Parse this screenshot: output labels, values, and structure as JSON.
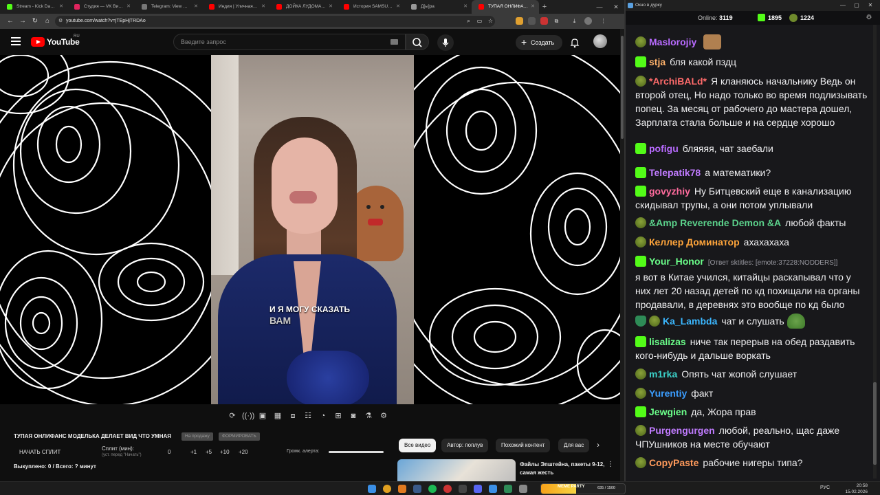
{
  "browser": {
    "tabs": [
      {
        "label": "Stream - Kick Dashboard",
        "color": "#53fc18"
      },
      {
        "label": "Студия — VK Видео | Стрим",
        "color": "#e0245e"
      },
      {
        "label": "Telegram: View @agree",
        "color": "#777777"
      },
      {
        "label": "Индия | Уличная Медь...",
        "color": "#ff0000"
      },
      {
        "label": "ДОЙКА ЛУДОМАНОВ",
        "color": "#ff0000"
      },
      {
        "label": "История SAMSUNG. К...",
        "color": "#ff0000"
      },
      {
        "label": "Д[ы]ра",
        "color": "#999999"
      },
      {
        "label": "ТУПАЯ ОНЛИФАНС М...",
        "color": "#ff0000",
        "active": true
      }
    ],
    "url": "youtube.com/watch?v=jTEpHjTRDAo"
  },
  "youtube": {
    "logo_text": "YouTube",
    "region": "RU",
    "search_placeholder": "Введите запрос",
    "create_label": "Создать",
    "caption_line1": "И Я МОГУ СКАЗАТЬ",
    "caption_line2": "ВАМ",
    "video_title": "ТУПАЯ ОНЛИФАНС МОДЕЛЬКА ДЕЛАЕТ ВИД ЧТО УМНАЯ",
    "pill_1": "На продажу",
    "pill_2": "ФОРМИРОВАТЬ",
    "split_start": "НАЧАТЬ СПЛИТ",
    "split_min_label": "Сплит (мин):",
    "split_min_hint": "(уст. перед \"Начать\")",
    "split_values": [
      "0",
      "+1",
      "+5",
      "+10",
      "+20"
    ],
    "alert_volume_label": "Громк. алерта:",
    "alert_volume_level": 1.0,
    "summary": "Выкуплено: 0 / Всего: ? минут",
    "chips": [
      "Все видео",
      "Автор: поплув",
      "Похожий контент",
      "Для вас"
    ],
    "related_title": "Файлы Эпштейна, пакеты 9-12, самая жесть"
  },
  "chat": {
    "window_title": "Окно в дурку",
    "online_label": "Online:",
    "online_count": "3119",
    "kick_count": "1895",
    "other_count": "1224",
    "messages": [
      {
        "badges": [
          "pep"
        ],
        "user": "Maslorojiy",
        "color": "#b86bff",
        "text": "",
        "emote": "face"
      },
      {
        "badges": [
          "k"
        ],
        "user": "stja",
        "color": "#ffb26b",
        "text": "бля какой пздц"
      },
      {
        "badges": [
          "pep"
        ],
        "user": "*ArchiBALd*",
        "color": "#ff6b6b",
        "text": "Я кланяюсь начальнику Ведь он второй отец, Но надо только во время подлизывать попец. За месяц от рабочего до мастера дошел, Зарплата стала больше и на сердце хорошо"
      },
      {
        "badges": [
          "k"
        ],
        "user": "pofigu",
        "color": "#b86bff",
        "text": "бляяяя, чат заебали"
      },
      {
        "badges": [
          "k"
        ],
        "user": "Telepatik78",
        "color": "#c07bff",
        "text": "а математики?"
      },
      {
        "badges": [
          "k"
        ],
        "user": "govyzhiy",
        "color": "#ff6b9d",
        "text": "Ну Битцевский еще в канализацию скидывал трупы, а они потом уплывали"
      },
      {
        "badges": [
          "pep"
        ],
        "user": "&Amp Reverende Demon &A",
        "color": "#5bd18b",
        "text": "любой факты"
      },
      {
        "badges": [
          "pep"
        ],
        "user": "Келлер Доминатор",
        "color": "#ffa53b",
        "text": "ахахахаха"
      },
      {
        "badges": [
          "k"
        ],
        "user": "Your_Honor",
        "color": "#6bff8a",
        "reply": "[Ответ sktitles: [emote:37228:NODDERS]]",
        "text": "я вот в Китае учился, китайцы раскапывал что у них лет 20 назад детей по кд похищали на органы продавали, в деревнях это вообще по кд было"
      },
      {
        "badges": [
          "shield",
          "pep"
        ],
        "user": "Ka_Lambda",
        "color": "#3bb7ff",
        "text": "чат и слушать",
        "emote": "frog"
      },
      {
        "badges": [
          "k"
        ],
        "user": "lisalizas",
        "color": "#6bff8a",
        "text": "ниче так перерыв на обед раздавить кого-нибудь и дальше воркать"
      },
      {
        "badges": [
          "pep"
        ],
        "user": "m1rka",
        "color": "#3bd1c9",
        "text": "Опять чат жопой слушает"
      },
      {
        "badges": [
          "pep"
        ],
        "user": "Yurentiy",
        "color": "#3b9dff",
        "text": "факт"
      },
      {
        "badges": [
          "k"
        ],
        "user": "Jewgien",
        "color": "#6bff8a",
        "text": "да, Жора прав"
      },
      {
        "badges": [
          "pep"
        ],
        "user": "Purgengurgen",
        "color": "#c07bff",
        "text": "любой, реально, щас даже ЧПУшников на месте обучают"
      },
      {
        "badges": [
          "pep"
        ],
        "user": "CopyPaste",
        "color": "#ff9a5b",
        "text": "рабочие нигеры типа?"
      }
    ]
  },
  "taskbar": {
    "widget_label": "MEME PARTY",
    "widget_count": "635 / 1500",
    "widget_progress": 0.42,
    "lang": "РУС",
    "time": "20:58",
    "date": "15.02.2026"
  }
}
